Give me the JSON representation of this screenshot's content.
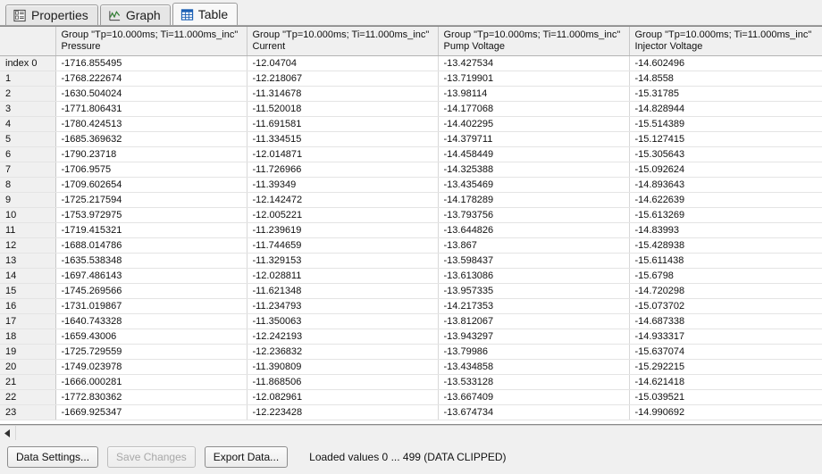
{
  "tabs": [
    {
      "label": "Properties",
      "icon": "properties-list-icon",
      "active": false
    },
    {
      "label": "Graph",
      "icon": "graph-chart-icon",
      "active": false
    },
    {
      "label": "Table",
      "icon": "table-grid-icon",
      "active": true
    }
  ],
  "table": {
    "group_label": "Group \"Tp=10.000ms; Ti=11.000ms_inc\"",
    "index_header": "",
    "columns": [
      {
        "group": "Group \"Tp=10.000ms; Ti=11.000ms_inc\"",
        "name": "Pressure"
      },
      {
        "group": "Group \"Tp=10.000ms; Ti=11.000ms_inc\"",
        "name": "Current"
      },
      {
        "group": "Group \"Tp=10.000ms; Ti=11.000ms_inc\"",
        "name": "Pump Voltage"
      },
      {
        "group": "Group \"Tp=10.000ms; Ti=11.000ms_inc\"",
        "name": "Injector Voltage"
      }
    ],
    "rows": [
      {
        "index": "index 0",
        "pressure": "-1716.855495",
        "current": "-12.04704",
        "pump": "-13.427534",
        "injector": "-14.602496"
      },
      {
        "index": "1",
        "pressure": "-1768.222674",
        "current": "-12.218067",
        "pump": "-13.719901",
        "injector": "-14.8558"
      },
      {
        "index": "2",
        "pressure": "-1630.504024",
        "current": "-11.314678",
        "pump": "-13.98114",
        "injector": "-15.31785"
      },
      {
        "index": "3",
        "pressure": "-1771.806431",
        "current": "-11.520018",
        "pump": "-14.177068",
        "injector": "-14.828944"
      },
      {
        "index": "4",
        "pressure": "-1780.424513",
        "current": "-11.691581",
        "pump": "-14.402295",
        "injector": "-15.514389"
      },
      {
        "index": "5",
        "pressure": "-1685.369632",
        "current": "-11.334515",
        "pump": "-14.379711",
        "injector": "-15.127415"
      },
      {
        "index": "6",
        "pressure": "-1790.23718",
        "current": "-12.014871",
        "pump": "-14.458449",
        "injector": "-15.305643"
      },
      {
        "index": "7",
        "pressure": "-1706.9575",
        "current": "-11.726966",
        "pump": "-14.325388",
        "injector": "-15.092624"
      },
      {
        "index": "8",
        "pressure": "-1709.602654",
        "current": "-11.39349",
        "pump": "-13.435469",
        "injector": "-14.893643"
      },
      {
        "index": "9",
        "pressure": "-1725.217594",
        "current": "-12.142472",
        "pump": "-14.178289",
        "injector": "-14.622639"
      },
      {
        "index": "10",
        "pressure": "-1753.972975",
        "current": "-12.005221",
        "pump": "-13.793756",
        "injector": "-15.613269"
      },
      {
        "index": "11",
        "pressure": "-1719.415321",
        "current": "-11.239619",
        "pump": "-13.644826",
        "injector": "-14.83993"
      },
      {
        "index": "12",
        "pressure": "-1688.014786",
        "current": "-11.744659",
        "pump": "-13.867",
        "injector": "-15.428938"
      },
      {
        "index": "13",
        "pressure": "-1635.538348",
        "current": "-11.329153",
        "pump": "-13.598437",
        "injector": "-15.611438"
      },
      {
        "index": "14",
        "pressure": "-1697.486143",
        "current": "-12.028811",
        "pump": "-13.613086",
        "injector": "-15.6798"
      },
      {
        "index": "15",
        "pressure": "-1745.269566",
        "current": "-11.621348",
        "pump": "-13.957335",
        "injector": "-14.720298"
      },
      {
        "index": "16",
        "pressure": "-1731.019867",
        "current": "-11.234793",
        "pump": "-14.217353",
        "injector": "-15.073702"
      },
      {
        "index": "17",
        "pressure": "-1640.743328",
        "current": "-11.350063",
        "pump": "-13.812067",
        "injector": "-14.687338"
      },
      {
        "index": "18",
        "pressure": "-1659.43006",
        "current": "-12.242193",
        "pump": "-13.943297",
        "injector": "-14.933317"
      },
      {
        "index": "19",
        "pressure": "-1725.729559",
        "current": "-12.236832",
        "pump": "-13.79986",
        "injector": "-15.637074"
      },
      {
        "index": "20",
        "pressure": "-1749.023978",
        "current": "-11.390809",
        "pump": "-13.434858",
        "injector": "-15.292215"
      },
      {
        "index": "21",
        "pressure": "-1666.000281",
        "current": "-11.868506",
        "pump": "-13.533128",
        "injector": "-14.621418"
      },
      {
        "index": "22",
        "pressure": "-1772.830362",
        "current": "-12.082961",
        "pump": "-13.667409",
        "injector": "-15.039521"
      },
      {
        "index": "23",
        "pressure": "-1669.925347",
        "current": "-12.223428",
        "pump": "-13.674734",
        "injector": "-14.990692"
      }
    ]
  },
  "bottom": {
    "data_settings_label": "Data Settings...",
    "save_changes_label": "Save Changes",
    "export_data_label": "Export Data...",
    "status": "Loaded values 0 ... 499 (DATA CLIPPED)"
  },
  "colors": {
    "window_bg": "#f0f0f0",
    "grid_bg": "#ffffff",
    "index_col_bg": "#f0f0f0",
    "graph_icon": "#2f7d32",
    "table_icon": "#1a5fb4"
  }
}
